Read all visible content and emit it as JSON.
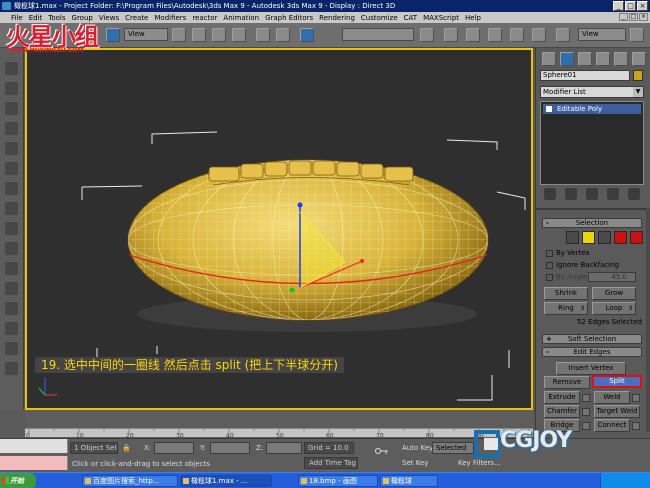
{
  "window": {
    "title": "橄榄球1.max    - Project Folder: F:\\Program Files\\Autodesk\\3ds Max 9    - Autodesk 3ds Max 9    - Display : Direct 3D"
  },
  "menu": [
    "File",
    "Edit",
    "Tools",
    "Group",
    "Views",
    "Create",
    "Modifiers",
    "reactor",
    "Animation",
    "Graph Editors",
    "Rendering",
    "Customize",
    "CAT",
    "MAXScript",
    "Help"
  ],
  "toolbar": {
    "view_select": "View",
    "view_select_right": "View"
  },
  "logo": {
    "text": "火星小组",
    "url": "WWW.HUXINGZU.COM"
  },
  "viewport": {
    "label": "",
    "caption": "19. 选中中间的一圈线 然后点击 split (把上下半球分开)"
  },
  "command_panel": {
    "object_name": "Sphere01",
    "object_color": "#cba520",
    "modifier_list": "Modifier List",
    "stack_item": "Editable Poly",
    "selection": {
      "title": "Selection",
      "by_vertex": "By Vertex",
      "ignore_backfacing": "Ignore Backfacing",
      "by_angle": "By Angle:",
      "angle_value": "45.0",
      "shrink": "Shrink",
      "grow": "Grow",
      "ring": "Ring",
      "loop": "Loop",
      "status": "52 Edges Selected"
    },
    "soft_selection": "Soft Selection",
    "edit_edges": {
      "title": "Edit Edges",
      "insert_vertex": "Insert Vertex",
      "remove": "Remove",
      "split": "Split",
      "extrude": "Extrude",
      "weld": "Weld",
      "chamfer": "Chamfer",
      "target_weld": "Target Weld",
      "bridge": "Bridge",
      "connect": "Connect"
    }
  },
  "timeline": {
    "ticks": [
      "0",
      "10",
      "20",
      "30",
      "40",
      "50",
      "60",
      "70",
      "80",
      "90",
      "100"
    ]
  },
  "status": {
    "objects": "1 Object Sele",
    "x_label": "X:",
    "y_label": "Y:",
    "z_label": "Z:",
    "grid": "Grid = 10.0",
    "prompt": "Click or click-and-drag to select objects",
    "add_time_tag": "Add Time Tag",
    "auto_key": "Auto Key",
    "auto_key_mode": "Selected",
    "set_key": "Set Key",
    "key_filters": "Key Filters..."
  },
  "watermark": {
    "text": "CGJOY"
  },
  "taskbar": {
    "start": "开始",
    "items": [
      "百度图片搜索_http...",
      "橄榄球1.max - ...",
      "18.bmp - 画图",
      "橄榄球"
    ]
  }
}
